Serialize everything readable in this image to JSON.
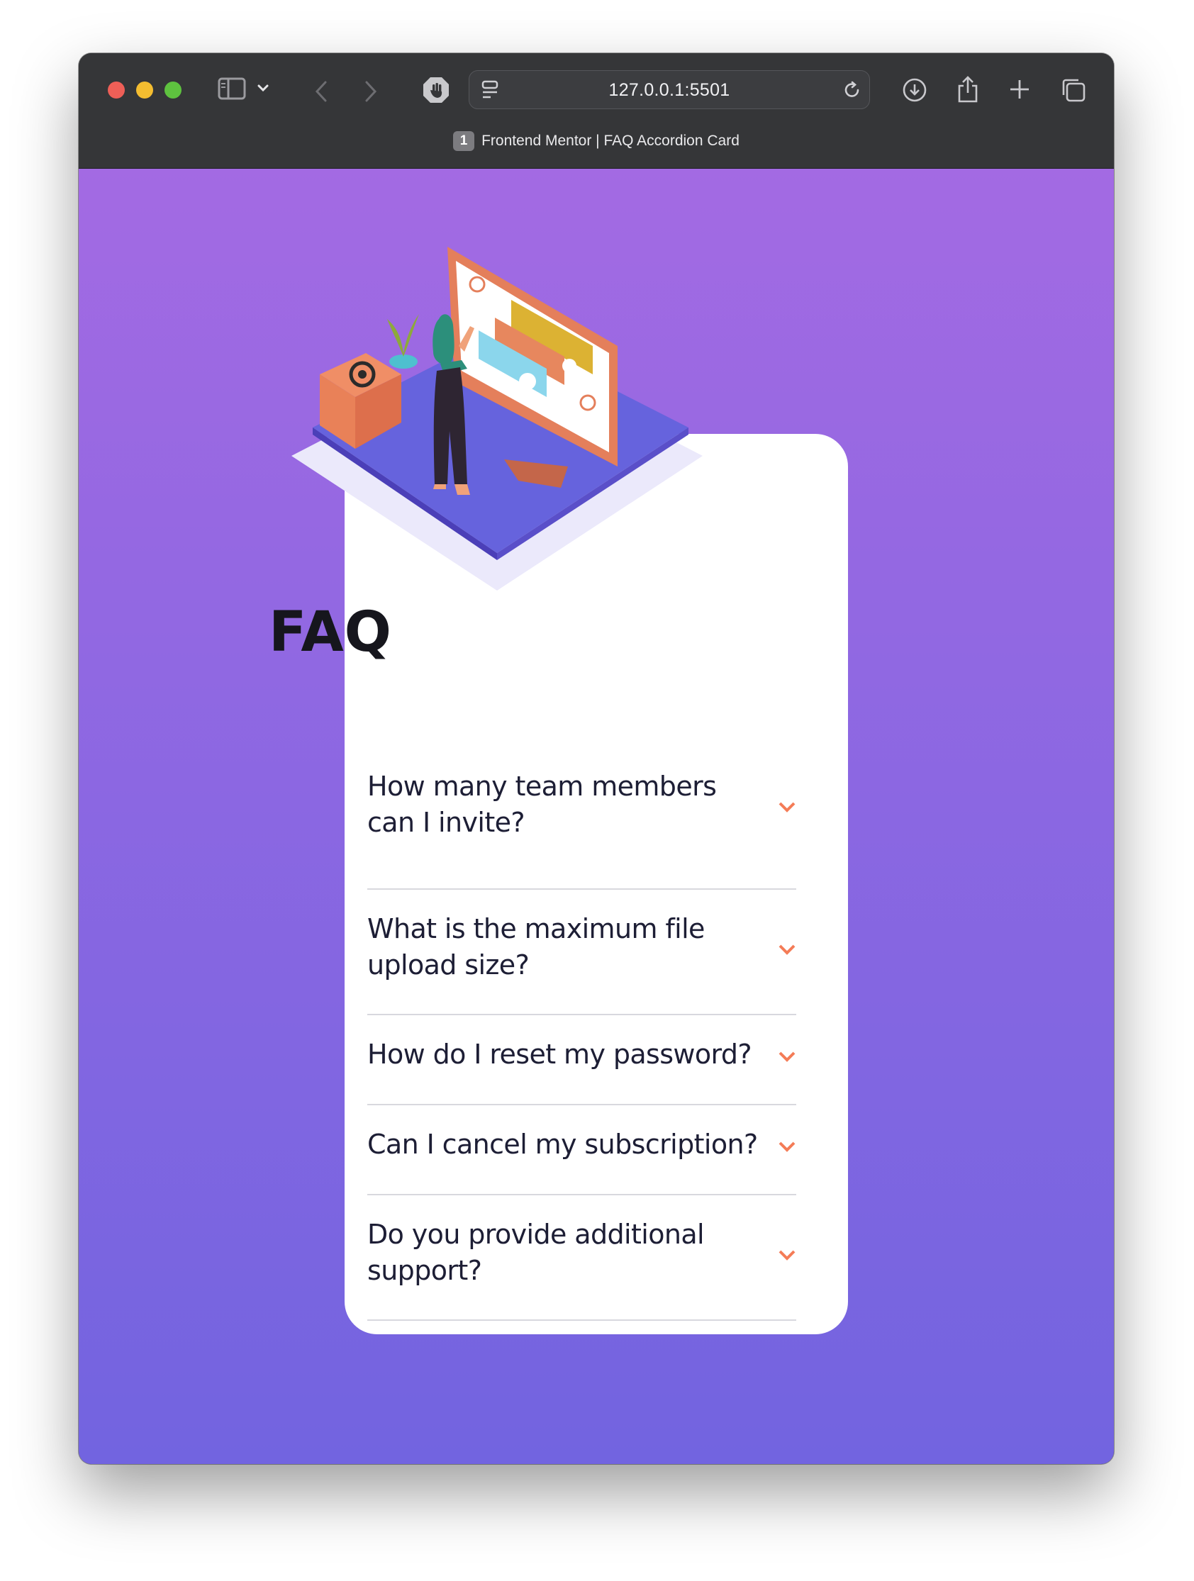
{
  "browser": {
    "url": "127.0.0.1:5501",
    "tab_number": "1",
    "tab_title": "Frontend Mentor | FAQ Accordion Card"
  },
  "colors": {
    "gradient_top": "#a36ae3",
    "gradient_bottom": "#7264e0",
    "accent": "#f47c57",
    "question_text": "#1d1e35"
  },
  "faq": {
    "title": "FAQ",
    "questions": [
      {
        "q": "How many team members can I invite?",
        "icon": "chevron-down-icon"
      },
      {
        "q": "What is the maximum file upload size?",
        "icon": "chevron-down-icon"
      },
      {
        "q": "How do I reset my password?",
        "icon": "chevron-down-icon"
      },
      {
        "q": "Can I cancel my subscription?",
        "icon": "chevron-down-icon"
      },
      {
        "q": "Do you provide additional support?",
        "icon": "chevron-down-icon"
      }
    ]
  }
}
